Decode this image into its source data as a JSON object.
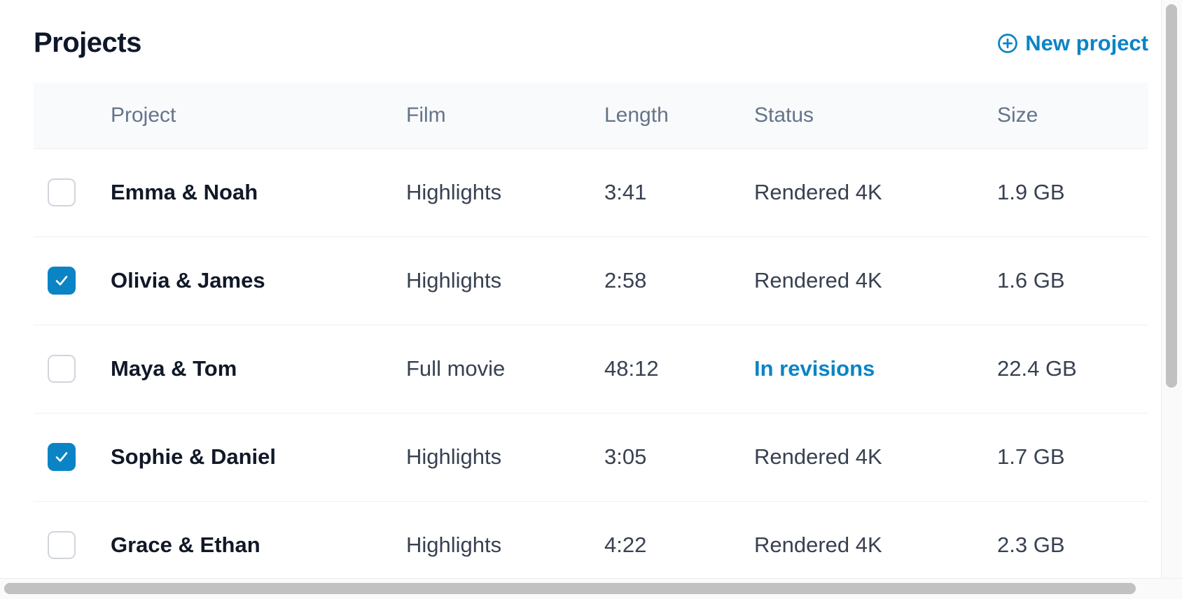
{
  "header": {
    "title": "Projects",
    "new_project_label": "New project"
  },
  "table": {
    "columns": [
      "Project",
      "Film",
      "Length",
      "Status",
      "Size"
    ],
    "rows": [
      {
        "checked": false,
        "project": "Emma & Noah",
        "film": "Highlights",
        "length": "3:41",
        "status": "Rendered 4K",
        "status_accent": false,
        "size": "1.9 GB"
      },
      {
        "checked": true,
        "project": "Olivia & James",
        "film": "Highlights",
        "length": "2:58",
        "status": "Rendered 4K",
        "status_accent": false,
        "size": "1.6 GB"
      },
      {
        "checked": false,
        "project": "Maya & Tom",
        "film": "Full movie",
        "length": "48:12",
        "status": "In revisions",
        "status_accent": true,
        "size": "22.4 GB"
      },
      {
        "checked": true,
        "project": "Sophie & Daniel",
        "film": "Highlights",
        "length": "3:05",
        "status": "Rendered 4K",
        "status_accent": false,
        "size": "1.7 GB"
      },
      {
        "checked": false,
        "project": "Grace & Ethan",
        "film": "Highlights",
        "length": "4:22",
        "status": "Rendered 4K",
        "status_accent": false,
        "size": "2.3 GB"
      }
    ]
  },
  "icons": {
    "new_project": "plus-circle-icon",
    "checkbox_check": "check-icon"
  },
  "colors": {
    "accent": "#0b84c6",
    "title": "#0f172a",
    "header_text": "#64748b",
    "body_text": "#374151",
    "checkbox_border": "#d1d5db"
  }
}
